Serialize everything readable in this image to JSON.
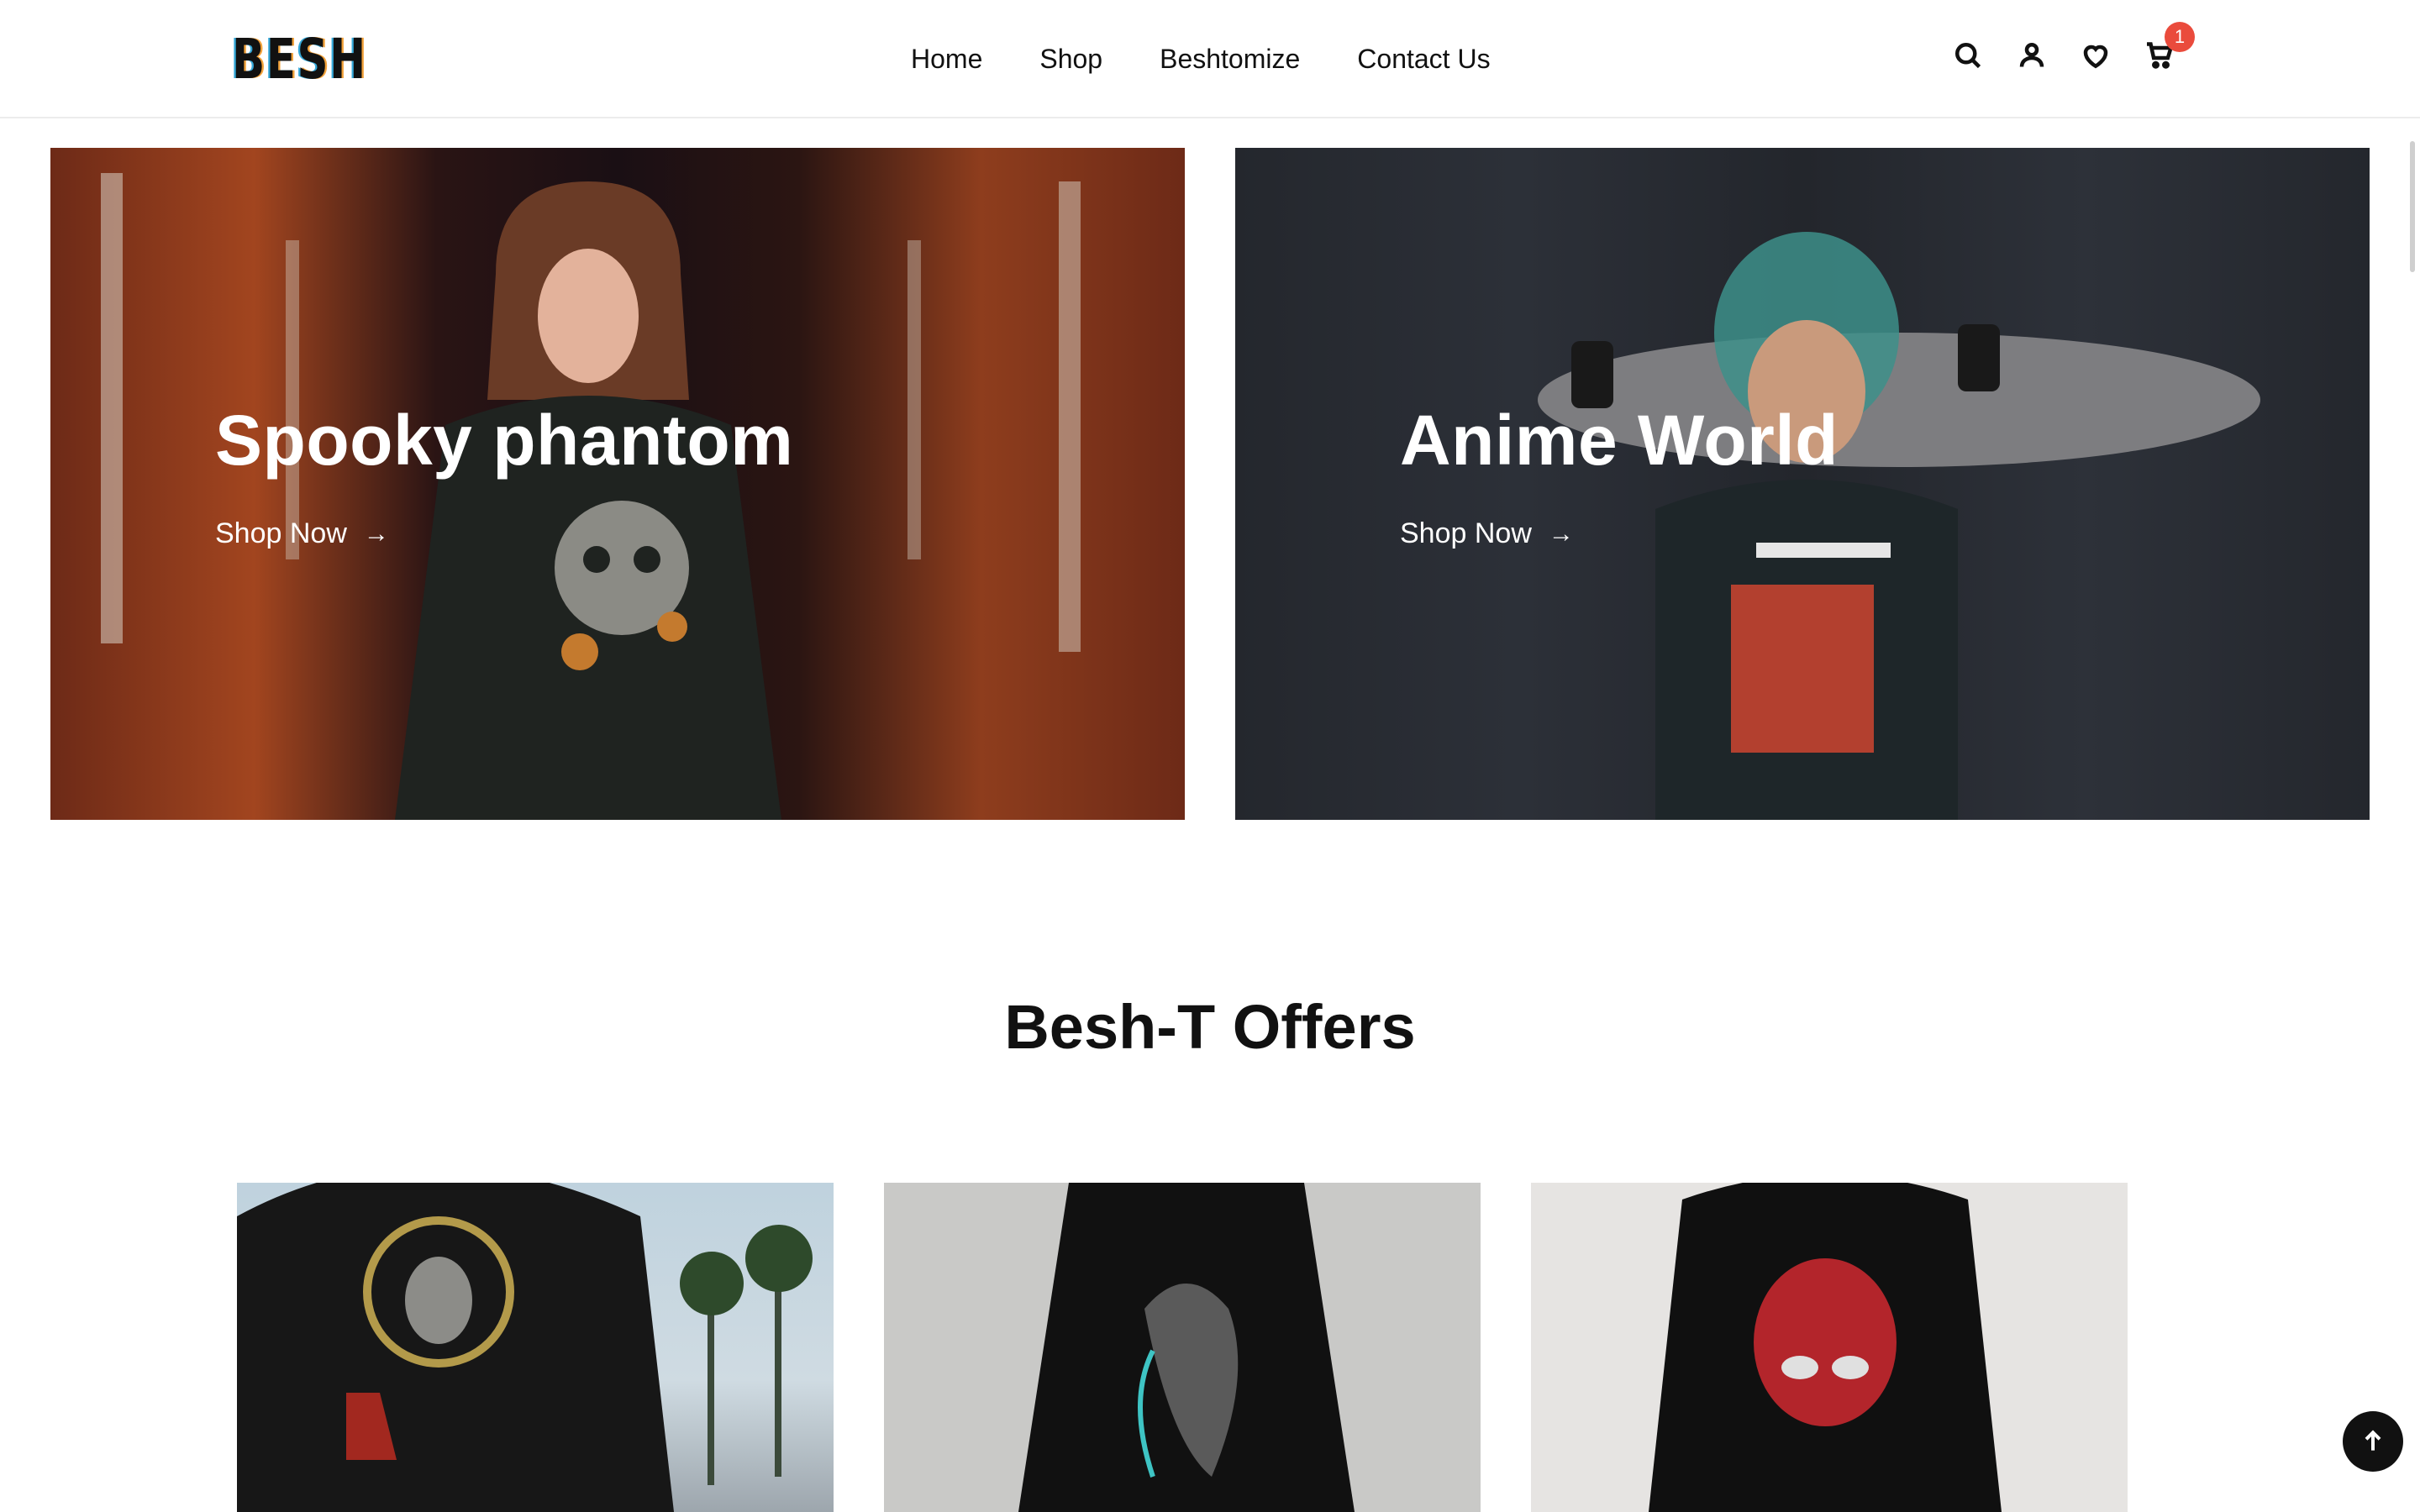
{
  "header": {
    "logo_text": "BESH",
    "nav": [
      "Home",
      "Shop",
      "Beshtomize",
      "Contact Us"
    ],
    "icons": [
      "search-icon",
      "account-icon",
      "heart-icon",
      "cart-icon"
    ],
    "cart_count": "1"
  },
  "banners": [
    {
      "title": "Spooky phantom",
      "link_label": "Shop Now",
      "link_icon": "arrow-right-icon"
    },
    {
      "title": "Anime World",
      "link_label": "Shop Now",
      "link_icon": "arrow-right-icon"
    }
  ],
  "offers": {
    "title": "Besh-T Offers"
  },
  "colors": {
    "badge": "#ea4b3c",
    "text": "#111111"
  },
  "back_to_top_icon": "arrow-up-icon"
}
